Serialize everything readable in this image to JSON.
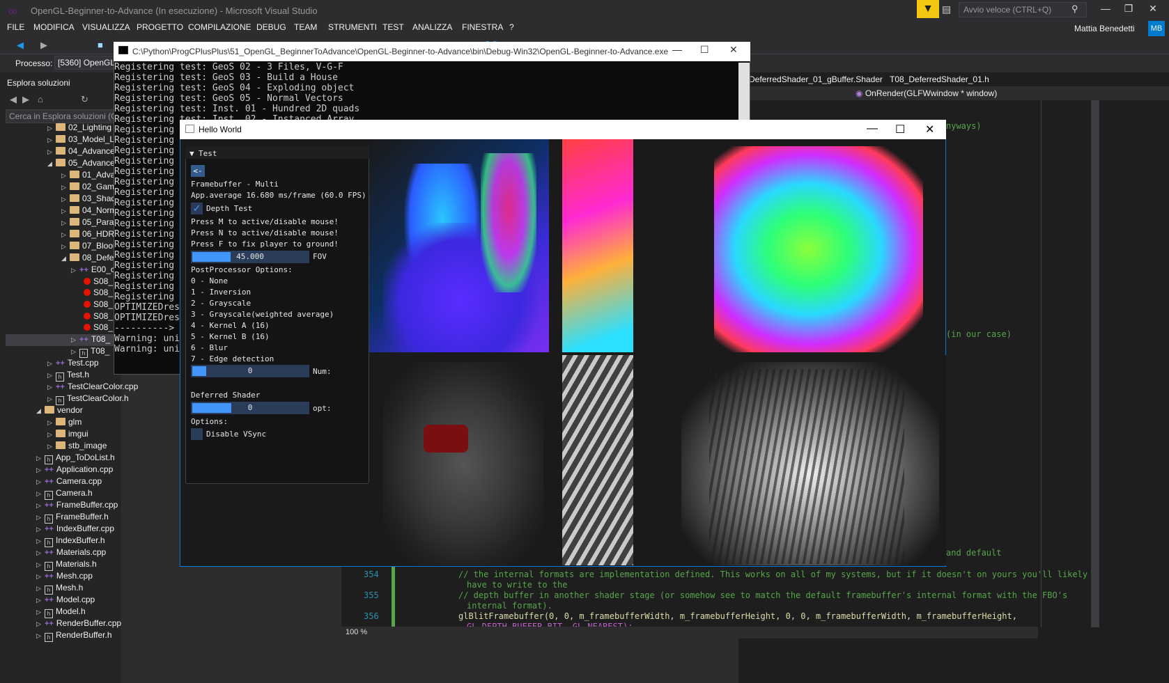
{
  "app": {
    "title": "OpenGL-Beginner-to-Advance (In esecuzione) - Microsoft Visual Studio",
    "quick_launch_placeholder": "Avvio veloce (CTRL+Q)",
    "user": "Mattia Benedetti",
    "user_initials": "MB"
  },
  "menu": [
    "FILE",
    "MODIFICA",
    "VISUALIZZA",
    "PROGETTO",
    "COMPILAZIONE",
    "DEBUG",
    "TEAM",
    "STRUMENTI",
    "TEST",
    "ANALIZZA",
    "FINESTRA",
    "?"
  ],
  "process": {
    "label": "Processo:",
    "value": "[5360] OpenGL-B"
  },
  "solution_explorer": {
    "title": "Esplora soluzioni",
    "search_placeholder": "Cerca in Esplora soluzioni (CTRL",
    "items": [
      {
        "label": "02_Lighting",
        "kind": "folder"
      },
      {
        "label": "03_Model_L",
        "kind": "folder"
      },
      {
        "label": "04_Advance",
        "kind": "folder"
      },
      {
        "label": "05_Advance",
        "kind": "folder"
      },
      {
        "label": "01_Adva",
        "kind": "folder"
      },
      {
        "label": "02_Gam",
        "kind": "folder"
      },
      {
        "label": "03_Shad",
        "kind": "folder"
      },
      {
        "label": "04_Norm",
        "kind": "folder"
      },
      {
        "label": "05_Paral",
        "kind": "folder"
      },
      {
        "label": "06_HDR",
        "kind": "folder"
      },
      {
        "label": "07_Bloor",
        "kind": "folder"
      },
      {
        "label": "08_Defer",
        "kind": "folder"
      },
      {
        "label": "E00_c",
        "kind": "cpp"
      },
      {
        "label": "S08_",
        "kind": "err"
      },
      {
        "label": "S08_",
        "kind": "err"
      },
      {
        "label": "S08_",
        "kind": "err"
      },
      {
        "label": "S08_",
        "kind": "err"
      },
      {
        "label": "S08_",
        "kind": "err"
      },
      {
        "label": "T08_",
        "kind": "cpp"
      },
      {
        "label": "T08_",
        "kind": "file"
      },
      {
        "label": "Test.cpp",
        "kind": "cpp"
      },
      {
        "label": "Test.h",
        "kind": "file"
      },
      {
        "label": "TestClearColor.cpp",
        "kind": "cpp"
      },
      {
        "label": "TestClearColor.h",
        "kind": "file"
      },
      {
        "label": "vendor",
        "kind": "folder"
      },
      {
        "label": "glm",
        "kind": "folder"
      },
      {
        "label": "imgui",
        "kind": "folder"
      },
      {
        "label": "stb_image",
        "kind": "folder"
      },
      {
        "label": "App_ToDoList.h",
        "kind": "file"
      },
      {
        "label": "Application.cpp",
        "kind": "cpp"
      },
      {
        "label": "Camera.cpp",
        "kind": "cpp"
      },
      {
        "label": "Camera.h",
        "kind": "file"
      },
      {
        "label": "FrameBuffer.cpp",
        "kind": "cpp"
      },
      {
        "label": "FrameBuffer.h",
        "kind": "file"
      },
      {
        "label": "IndexBuffer.cpp",
        "kind": "cpp"
      },
      {
        "label": "IndexBuffer.h",
        "kind": "file"
      },
      {
        "label": "Materials.cpp",
        "kind": "cpp"
      },
      {
        "label": "Materials.h",
        "kind": "file"
      },
      {
        "label": "Mesh.cpp",
        "kind": "cpp"
      },
      {
        "label": "Mesh.h",
        "kind": "file"
      },
      {
        "label": "Model.cpp",
        "kind": "cpp"
      },
      {
        "label": "Model.h",
        "kind": "file"
      },
      {
        "label": "RenderBuffer.cpp",
        "kind": "cpp"
      },
      {
        "label": "RenderBuffer.h",
        "kind": "file"
      }
    ]
  },
  "editor": {
    "tabs": [
      "DeferredShader_01_gBuffer.Shader",
      "T08_DeferredShader_01.h"
    ],
    "nav_function": "OnRender(GLFWwindow * window)",
    "fragments": [
      "nyways)",
      "(in our case)",
      "and default"
    ],
    "lines": [
      {
        "no": "354",
        "text": "// the internal formats are implementation defined. This works on all of my systems, but if it doesn't on yours you'll likely",
        "text2": "have to write to the"
      },
      {
        "no": "355",
        "text": "// depth buffer in another shader stage (or somehow see to match the default framebuffer's internal format with the FBO's",
        "text2": "internal format)."
      },
      {
        "no": "356",
        "text": "glBlitFramebuffer(0, 0, m_framebufferWidth, m_framebufferHeight, 0, 0, m_framebufferWidth, m_framebufferHeight,",
        "text2": "GL_DEPTH_BUFFER_BIT, GL_NEAREST);"
      }
    ],
    "zoom": "100 %"
  },
  "console": {
    "title": "C:\\Python\\ProgCPlusPlus\\51_OpenGL_BeginnerToAdvance\\OpenGL-Beginner-to-Advance\\bin\\Debug-Win32\\OpenGL-Beginner-to-Advance.exe",
    "lines": [
      "Registering test: GeoS 02 - 3 Files, V-G-F",
      "Registering test: GeoS 03 - Build a House",
      "Registering test: GeoS 04 - Exploding object",
      "Registering test: GeoS 05 - Normal Vectors",
      "Registering test: Inst. 01 - Hundred 2D quads",
      "Registering test: Inst. 02 - Instanced Array",
      "Registering t",
      "Registering t",
      "Registering t",
      "Registering t",
      "Registering t",
      "Registering t",
      "Registering t",
      "Registering t",
      "Registering t",
      "Registering t",
      "Registering t",
      "Registering t",
      "Registering t",
      "Registering t",
      "Registering t",
      "Registering t",
      "Registering t",
      "OPTIMIZEDres/",
      "OPTIMIZEDres/",
      "----------> E",
      "Warning: unif",
      "Warning: unif"
    ]
  },
  "hello_world": {
    "title": "Hello World",
    "imgui": {
      "header": "Test",
      "back": "<-",
      "lines": [
        "Framebuffer - Multi",
        "App.average 16.680 ms/frame (60.0 FPS)"
      ],
      "depth_test": "Depth Test",
      "press_lines": [
        "Press M to active/disable mouse!",
        "Press N to active/disable mouse!",
        "Press F to fix player to ground!"
      ],
      "fov_value": "45.000",
      "fov_label": "FOV",
      "fov_fraction": 0.33,
      "pp_title": "PostProcessor Options:",
      "pp_options": [
        "0 - None",
        "1 - Inversion",
        "2 - Grayscale",
        "3 - Grayscale(weighted average)",
        "4 - Kernel A (16)",
        "5 - Kernel B (16)",
        "6 - Blur",
        "7 - Edge detection"
      ],
      "num_value": "0",
      "num_label": "Num:",
      "num_fraction": 0.12,
      "deferred_title": "Deferred Shader",
      "opt_value": "0",
      "opt_label": "opt:",
      "opt_fraction": 0.34,
      "options_title": "Options:",
      "vsync": "Disable VSync"
    }
  },
  "colors": {
    "vs_bg": "#2d2d30",
    "accent": "#007acc",
    "imgui_blue": "#4296fa"
  }
}
